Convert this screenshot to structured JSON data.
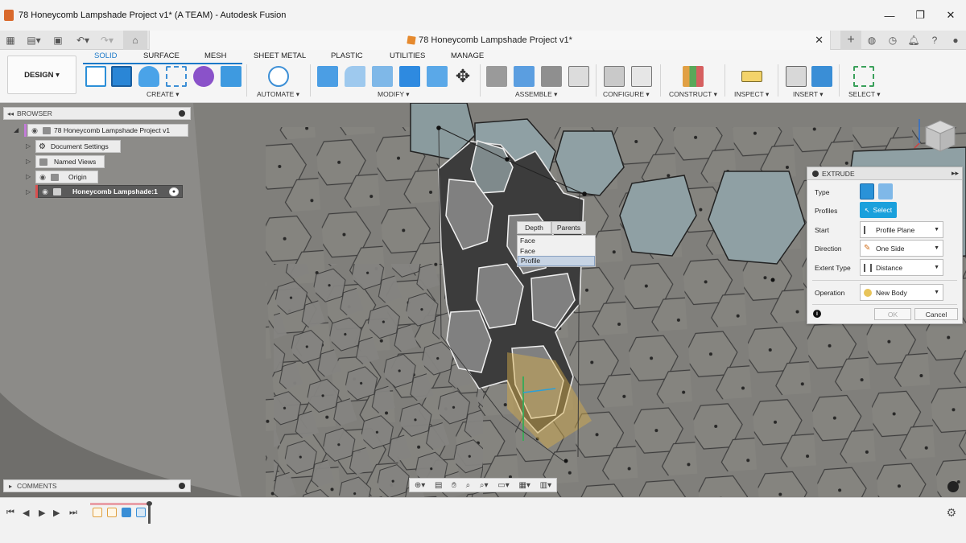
{
  "window": {
    "title": "78 Honeycomb Lampshade Project v1* (A TEAM) - Autodesk Fusion",
    "minimize": "—",
    "maximize": "❐",
    "close": "✕"
  },
  "doc_tab": {
    "title": "78 Honeycomb Lampshade Project v1*",
    "close": "✕"
  },
  "toolbar": {
    "workspace_label": "DESIGN ▾",
    "tabs": [
      "SOLID",
      "SURFACE",
      "MESH",
      "SHEET METAL",
      "PLASTIC",
      "UTILITIES",
      "MANAGE"
    ],
    "groups": [
      "CREATE ▾",
      "AUTOMATE ▾",
      "MODIFY ▾",
      "ASSEMBLE ▾",
      "CONFIGURE ▾",
      "CONSTRUCT ▾",
      "INSPECT ▾",
      "INSERT ▾",
      "SELECT ▾"
    ]
  },
  "browser": {
    "header": "BROWSER",
    "root": "78 Honeycomb Lampshade Project v1",
    "items": [
      {
        "label": "Document Settings"
      },
      {
        "label": "Named Views"
      },
      {
        "label": "Origin"
      },
      {
        "label": "Honeycomb Lampshade:1"
      }
    ]
  },
  "comments": {
    "header": "COMMENTS"
  },
  "context_menu": {
    "tabs": [
      "Depth",
      "Parents"
    ],
    "items": [
      "Face",
      "Face",
      "Profile"
    ],
    "highlighted_index": 2
  },
  "extrude_dialog": {
    "title": "EXTRUDE",
    "type_label": "Type",
    "profiles_label": "Profiles",
    "select_button": "Select",
    "start_label": "Start",
    "start_value": "Profile Plane",
    "direction_label": "Direction",
    "direction_value": "One Side",
    "extent_label": "Extent Type",
    "extent_value": "Distance",
    "operation_label": "Operation",
    "operation_value": "New Body",
    "ok": "OK",
    "cancel": "Cancel"
  },
  "colors": {
    "accent": "#1b78c8",
    "select_blue": "#1aa0dc",
    "viewport": "#7d7c7a"
  }
}
